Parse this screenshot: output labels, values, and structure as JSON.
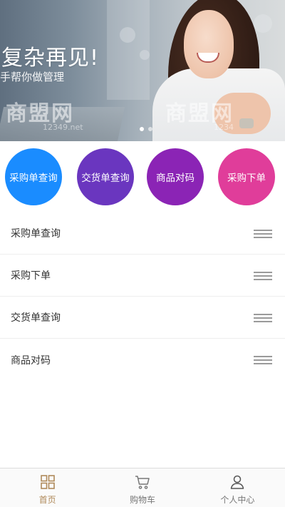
{
  "banner": {
    "title": "复杂再见!",
    "subtitle": "手帮你做管理",
    "watermark_left": "商盟网",
    "watermark_left_url": "12349.net",
    "watermark_right": "商盟网",
    "watermark_right_url": "1234"
  },
  "quick_actions": [
    {
      "label": "采购单查询",
      "color": "#1a8cff"
    },
    {
      "label": "交货单查询",
      "color": "#6a36bf"
    },
    {
      "label": "商品对码",
      "color": "#8b24b5"
    },
    {
      "label": "采购下单",
      "color": "#e03d9a"
    }
  ],
  "menu": [
    {
      "label": "采购单查询",
      "icon": "drag-handle-icon"
    },
    {
      "label": "采购下单",
      "icon": "drag-handle-icon"
    },
    {
      "label": "交货单查询",
      "icon": "drag-handle-icon"
    },
    {
      "label": "商品对码",
      "icon": "drag-handle-icon"
    }
  ],
  "tabbar": {
    "active_color": "#b08a5a",
    "inactive_color": "#777777",
    "tabs": [
      {
        "label": "首页",
        "icon": "grid-home-icon",
        "active": true
      },
      {
        "label": "购物车",
        "icon": "shopping-cart-icon",
        "active": false
      },
      {
        "label": "个人中心",
        "icon": "user-icon",
        "active": false
      }
    ]
  }
}
